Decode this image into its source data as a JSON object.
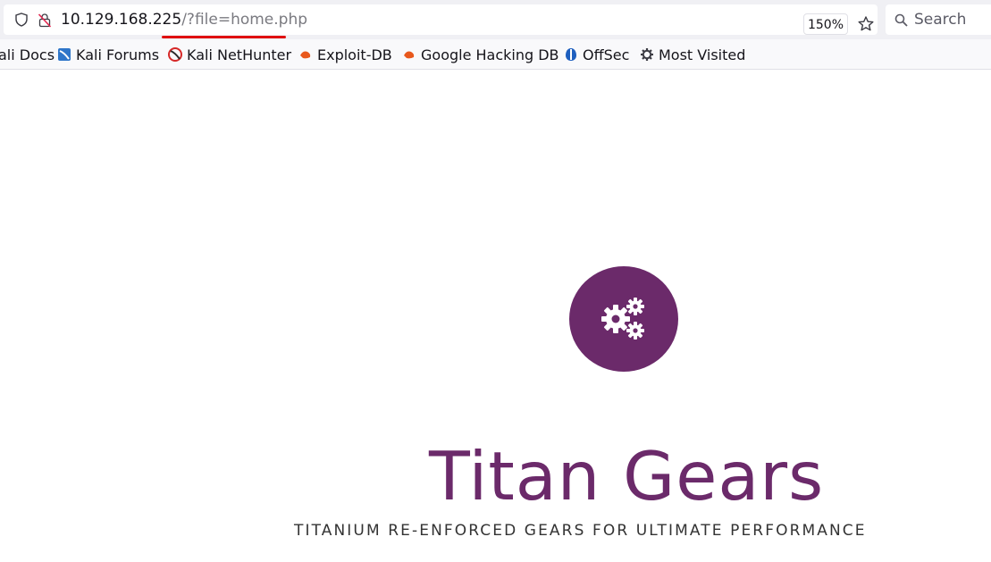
{
  "browser": {
    "url_host": "10.129.168.225",
    "url_path": "/?file=home.php",
    "zoom": "150%",
    "search_placeholder": "Search",
    "underline_color": "#e01010"
  },
  "bookmarks": [
    {
      "label": "ali Docs",
      "icon": "kali-docs-icon"
    },
    {
      "label": "Kali Forums",
      "icon": "kali-forums-icon"
    },
    {
      "label": "Kali NetHunter",
      "icon": "kali-nethunter-icon"
    },
    {
      "label": "Exploit-DB",
      "icon": "exploit-db-icon"
    },
    {
      "label": "Google Hacking DB",
      "icon": "exploit-db-icon"
    },
    {
      "label": "OffSec",
      "icon": "offsec-icon"
    },
    {
      "label": "Most Visited",
      "icon": "gear-icon"
    }
  ],
  "page": {
    "brand": "Titan Gears",
    "tagline": "TITANIUM RE-ENFORCED GEARS FOR ULTIMATE PERFORMANCE",
    "brand_color": "#6b2a6a",
    "logo_icon": "gears-icon"
  }
}
